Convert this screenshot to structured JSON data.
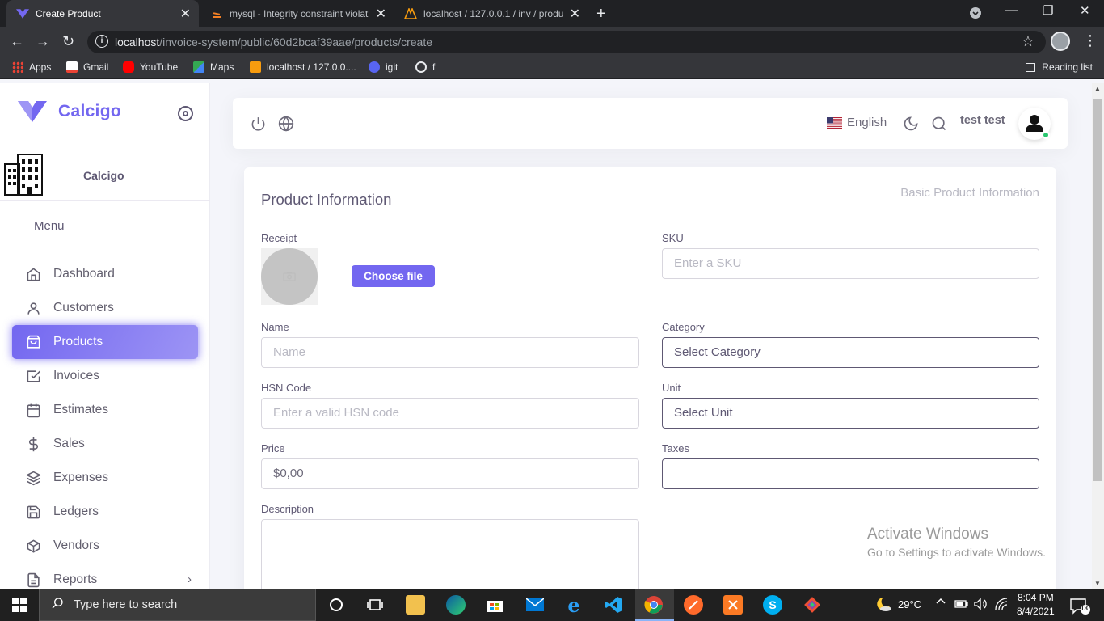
{
  "browser": {
    "tabs": [
      {
        "title": "Create Product",
        "active": true
      },
      {
        "title": "mysql - Integrity constraint violat",
        "active": false
      },
      {
        "title": "localhost / 127.0.0.1 / inv / produ",
        "active": false
      }
    ],
    "url_host": "localhost",
    "url_path": "/invoice-system/public/60d2bcaf39aae/products/create",
    "bookmarks": [
      "Apps",
      "Gmail",
      "YouTube",
      "Maps",
      "localhost / 127.0.0....",
      "igit",
      "f"
    ],
    "reading_list": "Reading list"
  },
  "sidebar": {
    "brand": "Calcigo",
    "company_name": "Calcigo",
    "menu_header": "Menu",
    "items": [
      {
        "label": "Dashboard",
        "icon": "home-icon"
      },
      {
        "label": "Customers",
        "icon": "user-icon"
      },
      {
        "label": "Products",
        "icon": "shopping-bag-icon",
        "active": true
      },
      {
        "label": "Invoices",
        "icon": "check-square-icon"
      },
      {
        "label": "Estimates",
        "icon": "calendar-icon"
      },
      {
        "label": "Sales",
        "icon": "dollar-sign-icon"
      },
      {
        "label": "Expenses",
        "icon": "layers-icon"
      },
      {
        "label": "Ledgers",
        "icon": "save-icon"
      },
      {
        "label": "Vendors",
        "icon": "package-icon"
      },
      {
        "label": "Reports",
        "icon": "file-text-icon"
      }
    ],
    "accent": "#7367f0"
  },
  "navbar": {
    "language": "English",
    "user_name": "test test"
  },
  "form": {
    "title": "Product Information",
    "subtitle": "Basic Product Information",
    "receipt_label": "Receipt",
    "choose_file": "Choose file",
    "sku_label": "SKU",
    "sku_placeholder": "Enter a SKU",
    "name_label": "Name",
    "name_placeholder": "Name",
    "category_label": "Category",
    "category_value": "Select Category",
    "hsn_label": "HSN Code",
    "hsn_placeholder": "Enter a valid HSN code",
    "unit_label": "Unit",
    "unit_value": "Select Unit",
    "price_label": "Price",
    "price_value": "$0,00",
    "taxes_label": "Taxes",
    "taxes_value": "",
    "description_label": "Description"
  },
  "watermark": {
    "line1": "Activate Windows",
    "line2": "Go to Settings to activate Windows."
  },
  "taskbar": {
    "search_text": "Type here to search",
    "temperature": "29°C",
    "time": "8:04 PM",
    "date": "8/4/2021",
    "notifications": "13"
  }
}
